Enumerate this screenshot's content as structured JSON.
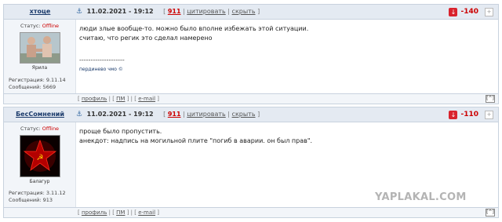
{
  "posts": [
    {
      "author": "хтоце",
      "date": "11.02.2021 - 19:12",
      "count": "911",
      "quote_label": "цитировать",
      "hide_label": "скрыть",
      "rating": "-140",
      "status_label": "Статус:",
      "status_value": "Offline",
      "avatar_caption": "Ярила",
      "registration": "Регистрация: 9.11.14",
      "messages": "Сообщений: 5669",
      "lines": [
        "люди злые вообще-то. можно было вполне избежать этой ситуации.",
        "считаю, что регик это сделал намерено"
      ],
      "signature_line": "--------------------",
      "signature": "пердинево чмо ©",
      "footer": {
        "profile": "профиль",
        "pm": "ПМ",
        "email": "e-mail"
      }
    },
    {
      "author": "БесСомнений",
      "date": "11.02.2021 - 19:12",
      "count": "911",
      "quote_label": "цитировать",
      "hide_label": "скрыть",
      "rating": "-110",
      "status_label": "Статус:",
      "status_value": "Offline",
      "avatar_caption": "Балагур",
      "registration": "Регистрация: 3.11.12",
      "messages": "Сообщений: 913",
      "lines": [
        "проще было пропустить.",
        "анекдот: надпись на могильной плите \"погиб в аварии. он был прав\"."
      ],
      "footer": {
        "profile": "профиль",
        "pm": "ПМ",
        "email": "e-mail"
      }
    }
  ],
  "watermark": "YAPLAKAL.COM",
  "colors": {
    "header_bg": "#e4eaf2",
    "accent_red": "#cc0000",
    "link_blue": "#1a3a6b"
  },
  "icons": {
    "anchor": "anchor-icon",
    "rate_down": "rate-down-icon",
    "rate_up": "rate-up-icon",
    "to_top": "to-top-icon"
  }
}
